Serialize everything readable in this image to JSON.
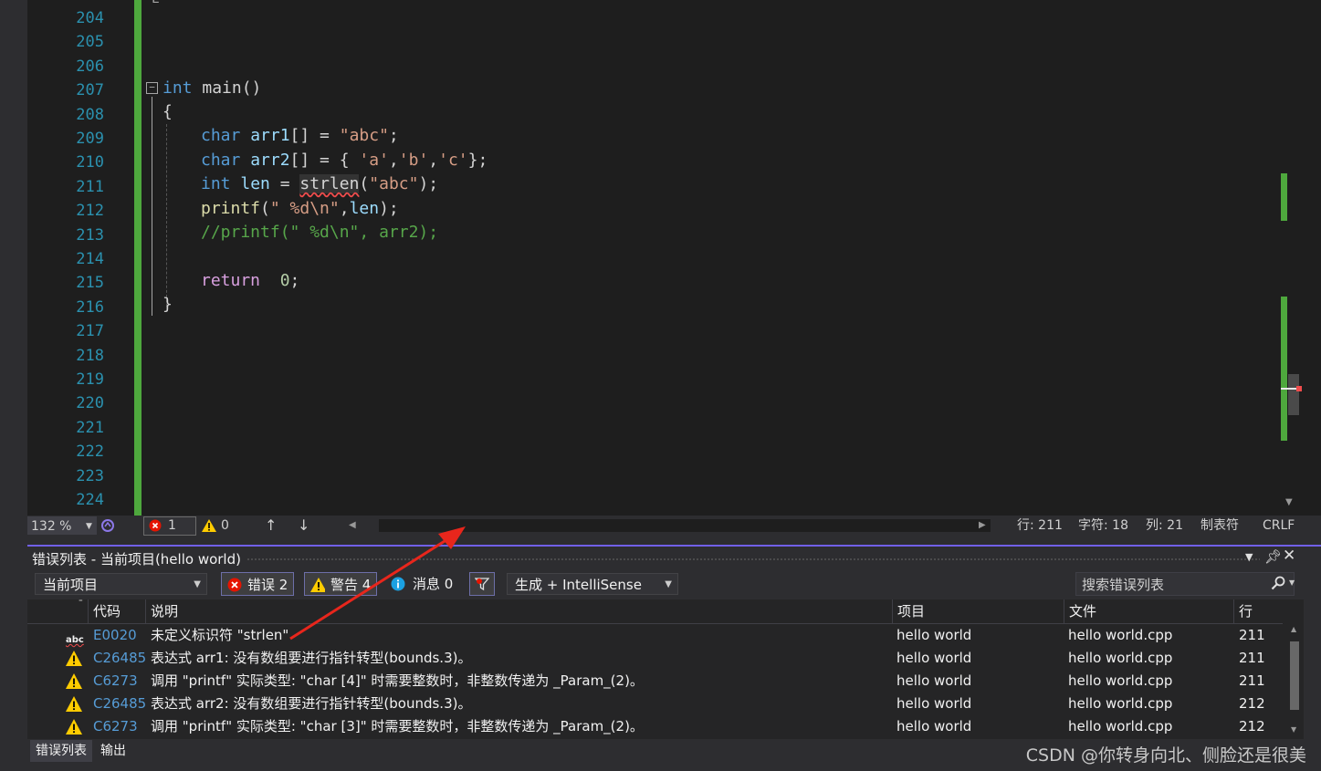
{
  "editor": {
    "line_numbers": [
      "204",
      "205",
      "206",
      "207",
      "208",
      "209",
      "210",
      "211",
      "212",
      "213",
      "214",
      "215",
      "216",
      "217",
      "218",
      "219",
      "220",
      "221",
      "222",
      "223",
      "224"
    ],
    "top_partial": "L",
    "code": {
      "l207_kw": "int",
      "l207_fn": " main()",
      "l208": "{",
      "l209_kw": "char",
      "l209_var": " arr1",
      "l209_rest": "[] = ",
      "l209_str": "\"abc\"",
      "l209_end": ";",
      "l210_kw": "char",
      "l210_var": " arr2",
      "l210_rest": "[] = { ",
      "l210_s1": "'a'",
      "l210_c1": ",",
      "l210_s2": "'b'",
      "l210_c2": ",",
      "l210_s3": "'c'",
      "l210_end": "};",
      "l211_kw": "int",
      "l211_var": " len",
      "l211_eq": " = ",
      "l211_fn": "strlen",
      "l211_p1": "(",
      "l211_str": "\"abc\"",
      "l211_end": ");",
      "l212_fn": "printf",
      "l212_p1": "(",
      "l212_str": "\" %d\\n\"",
      "l212_c": ",",
      "l212_var": "len",
      "l212_end": ");",
      "l213_cmt": "//printf(\" %d\\n\", arr2);",
      "l215_kw": "return",
      "l215_num": "  0",
      "l215_end": ";",
      "l216": "}",
      "collapse_glyph": "−"
    }
  },
  "statusbar": {
    "zoom": "132 %",
    "errors": "1",
    "warnings": "0",
    "line": "行: 211",
    "char": "字符: 18",
    "col": "列: 21",
    "tab": "制表符",
    "eol": "CRLF"
  },
  "panel": {
    "title": "错误列表 - 当前项目(hello world)",
    "scope": "当前项目",
    "errors_btn": "错误 2",
    "warnings_btn": "警告 4",
    "messages_btn": "消息 0",
    "source": "生成 + IntelliSense",
    "search_placeholder": "搜索错误列表",
    "columns": [
      "代码",
      "说明",
      "项目",
      "文件",
      "行"
    ],
    "rows": [
      {
        "type": "error",
        "code": "E0020",
        "desc": "未定义标识符 \"strlen\"",
        "project": "hello world",
        "file": "hello world.cpp",
        "line": "211"
      },
      {
        "type": "warning",
        "code": "C26485",
        "desc": "表达式 arr1: 没有数组要进行指针转型(bounds.3)。",
        "project": "hello world",
        "file": "hello world.cpp",
        "line": "211"
      },
      {
        "type": "warning",
        "code": "C6273",
        "desc": "调用 \"printf\" 实际类型: \"char [4]\" 时需要整数时，非整数传递为 _Param_(2)。",
        "project": "hello world",
        "file": "hello world.cpp",
        "line": "211"
      },
      {
        "type": "warning",
        "code": "C26485",
        "desc": "表达式 arr2: 没有数组要进行指针转型(bounds.3)。",
        "project": "hello world",
        "file": "hello world.cpp",
        "line": "212"
      },
      {
        "type": "warning",
        "code": "C6273",
        "desc": "调用 \"printf\" 实际类型: \"char [3]\" 时需要整数时，非整数传递为 _Param_(2)。",
        "project": "hello world",
        "file": "hello world.cpp",
        "line": "212"
      }
    ],
    "abc_icon_text": "abc"
  },
  "bottom_tabs": [
    "错误列表",
    "输出"
  ],
  "watermark": "CSDN @你转身向北、侧脸还是很美",
  "colors": {
    "accent": "#7160e8",
    "error": "#e51400",
    "warning": "#ffcc00",
    "info": "#1ba1e2",
    "change_bar": "#4ea83d",
    "annotation_arrow": "#e8261c"
  }
}
